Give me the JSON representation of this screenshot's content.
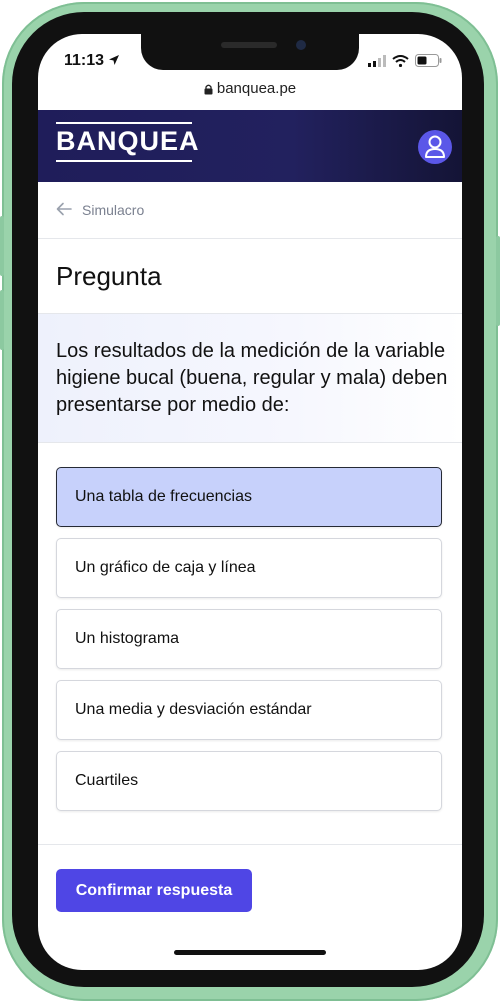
{
  "status_bar": {
    "time": "11:13"
  },
  "browser": {
    "url": "banquea.pe"
  },
  "header": {
    "logo_text": "BANQUEA"
  },
  "breadcrumb": {
    "label": "Simulacro"
  },
  "page": {
    "title": "Pregunta"
  },
  "question": {
    "text": "Los resultados de la medición de la variable higiene bucal (buena, regular y mala) deben presentarse por medio de:"
  },
  "options": [
    {
      "label": "Una tabla de frecuencias",
      "selected": true
    },
    {
      "label": "Un gráfico de caja y línea",
      "selected": false
    },
    {
      "label": "Un histograma",
      "selected": false
    },
    {
      "label": "Una media y desviación estándar",
      "selected": false
    },
    {
      "label": "Cuartiles",
      "selected": false
    }
  ],
  "actions": {
    "confirm_label": "Confirmar respuesta"
  },
  "colors": {
    "accent": "#4f46e5",
    "header_bg": "#1f1d5a",
    "selected_option_bg": "#c7d1fb",
    "device_frame": "#9ad3ab"
  }
}
